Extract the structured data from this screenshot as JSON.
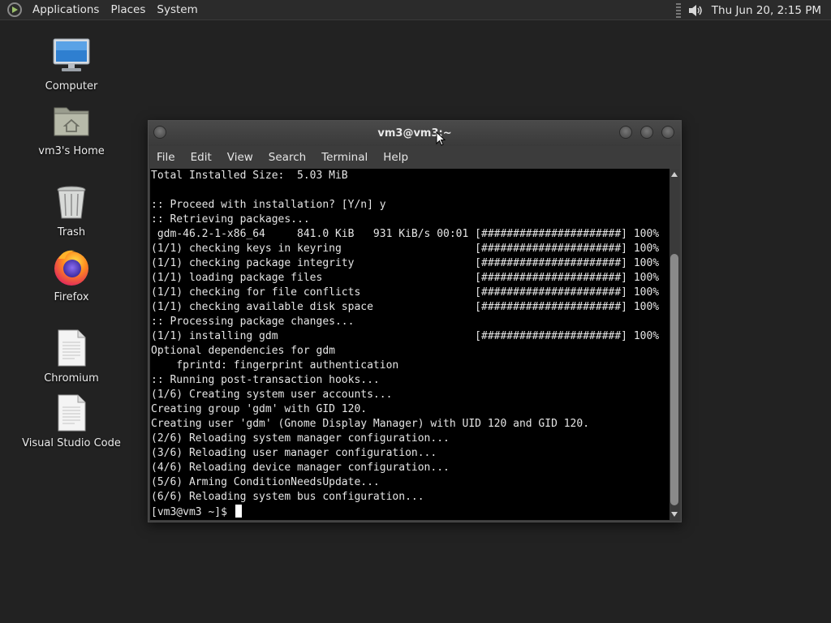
{
  "panel": {
    "menus": [
      "Applications",
      "Places",
      "System"
    ],
    "clock": "Thu Jun 20,  2:15 PM"
  },
  "desktop": {
    "icons": [
      {
        "label": "Computer",
        "icon": "computer-icon"
      },
      {
        "label": "vm3's Home",
        "icon": "home-folder-icon"
      },
      {
        "label": "Trash",
        "icon": "trash-icon"
      },
      {
        "label": "Firefox",
        "icon": "firefox-icon"
      },
      {
        "label": "Chromium",
        "icon": "document-icon"
      },
      {
        "label": "Visual Studio Code",
        "icon": "document-icon"
      }
    ]
  },
  "terminal": {
    "title": "vm3@vm3:~",
    "menu": [
      "File",
      "Edit",
      "View",
      "Search",
      "Terminal",
      "Help"
    ],
    "lines": [
      "Total Installed Size:  5.03 MiB",
      "",
      ":: Proceed with installation? [Y/n] y",
      ":: Retrieving packages...",
      " gdm-46.2-1-x86_64     841.0 KiB   931 KiB/s 00:01 [######################] 100%",
      "(1/1) checking keys in keyring                     [######################] 100%",
      "(1/1) checking package integrity                   [######################] 100%",
      "(1/1) loading package files                        [######################] 100%",
      "(1/1) checking for file conflicts                  [######################] 100%",
      "(1/1) checking available disk space                [######################] 100%",
      ":: Processing package changes...",
      "(1/1) installing gdm                               [######################] 100%",
      "Optional dependencies for gdm",
      "    fprintd: fingerprint authentication",
      ":: Running post-transaction hooks...",
      "(1/6) Creating system user accounts...",
      "Creating group 'gdm' with GID 120.",
      "Creating user 'gdm' (Gnome Display Manager) with UID 120 and GID 120.",
      "(2/6) Reloading system manager configuration...",
      "(3/6) Reloading user manager configuration...",
      "(4/6) Reloading device manager configuration...",
      "(5/6) Arming ConditionNeedsUpdate...",
      "(6/6) Reloading system bus configuration..."
    ],
    "prompt": "[vm3@vm3 ~]$ "
  },
  "colors": {
    "desktop_bg": "#222222",
    "panel_bg": "#2b2b2b",
    "terminal_bg": "#000000",
    "terminal_fg": "#e5e5e5"
  }
}
